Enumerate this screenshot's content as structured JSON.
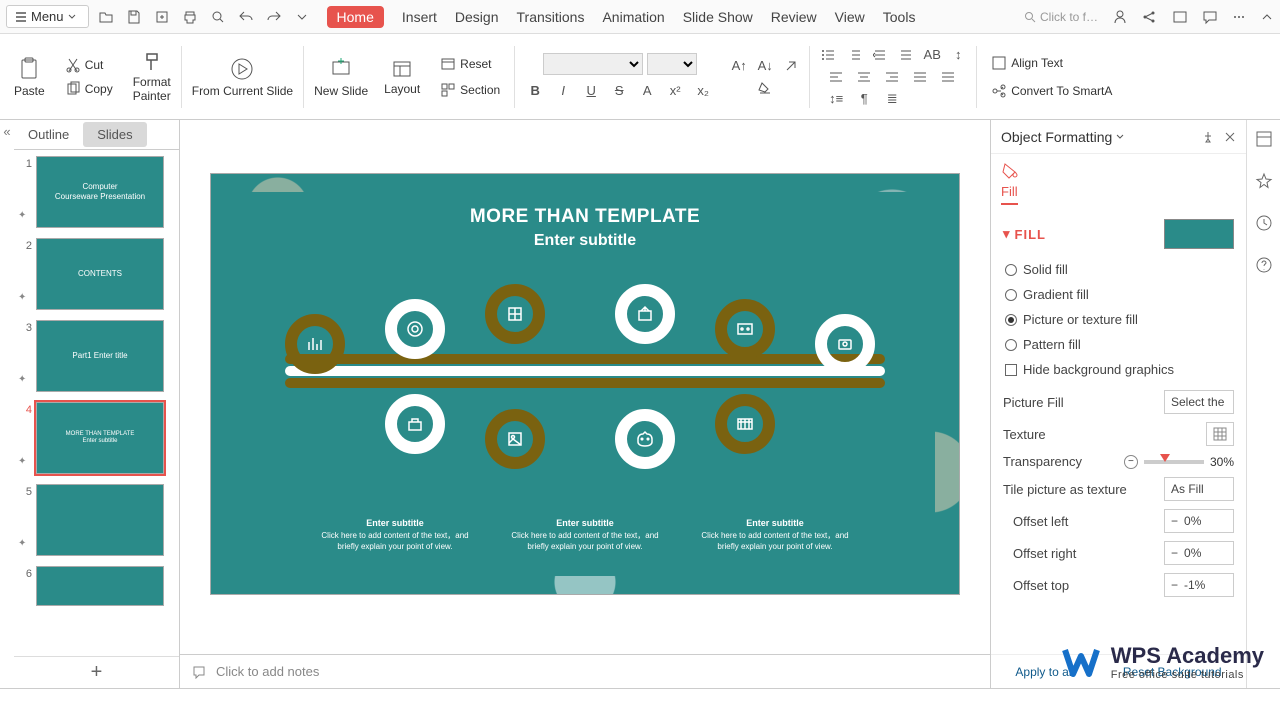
{
  "menu": {
    "label": "Menu"
  },
  "tabs": [
    "Home",
    "Insert",
    "Design",
    "Transitions",
    "Animation",
    "Slide Show",
    "Review",
    "View",
    "Tools"
  ],
  "active_tab": "Home",
  "search_placeholder": "Click to f…",
  "ribbon": {
    "paste": "Paste",
    "cut": "Cut",
    "copy": "Copy",
    "format_painter": "Format\nPainter",
    "from_current": "From Current Slide",
    "new_slide": "New Slide",
    "layout": "Layout",
    "reset": "Reset",
    "section": "Section",
    "align_text": "Align Text",
    "smartart": "Convert To SmartA"
  },
  "panel_tabs": {
    "outline": "Outline",
    "slides": "Slides"
  },
  "thumbs": [
    {
      "n": "1",
      "title": "Computer\nCourseware Presentation"
    },
    {
      "n": "2",
      "title": "CONTENTS"
    },
    {
      "n": "3",
      "title": "Part1  Enter title"
    },
    {
      "n": "4",
      "title": "MORE THAN TEMPLATE\nEnter subtitle"
    },
    {
      "n": "5",
      "title": ""
    },
    {
      "n": "6",
      "title": ""
    }
  ],
  "slide": {
    "title": "MORE THAN TEMPLATE",
    "subtitle": "Enter subtitle",
    "col_head": "Enter subtitle",
    "col_body": "Click here to add content of the text，and briefly explain your point of view."
  },
  "notes_placeholder": "Click to add notes",
  "format": {
    "title": "Object Formatting",
    "tab": "Fill",
    "section": "FILL",
    "opts": {
      "solid": "Solid fill",
      "gradient": "Gradient fill",
      "picture": "Picture or texture fill",
      "pattern": "Pattern fill",
      "hide": "Hide background graphics"
    },
    "picture_fill": "Picture Fill",
    "picture_fill_val": "Select the",
    "texture": "Texture",
    "transparency": "Transparency",
    "transparency_val": "30%",
    "tile": "Tile picture as texture",
    "tile_val": "As Fill",
    "offset_left": "Offset left",
    "offset_left_val": "0%",
    "offset_right": "Offset right",
    "offset_right_val": "0%",
    "offset_top": "Offset top",
    "offset_top_val": "-1%",
    "apply_all": "Apply to all",
    "reset_bg": "Reset Background"
  },
  "watermark": {
    "l1": "WPS Academy",
    "l2": "Free office suite tutorials"
  }
}
